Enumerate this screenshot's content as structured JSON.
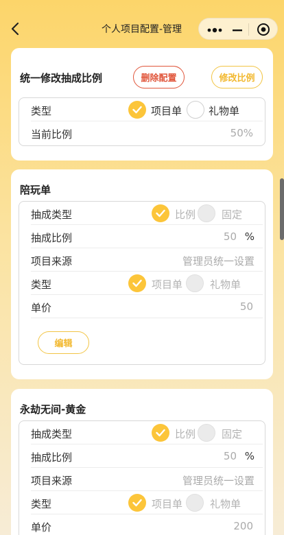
{
  "nav": {
    "title": "个人项目配置-管理"
  },
  "unified": {
    "title": "统一修改抽成比例",
    "delete_label": "删除配置",
    "edit_label": "修改比例",
    "type_label": "类型",
    "opt1": "项目单",
    "opt2": "礼物单",
    "ratio_label": "当前比例",
    "ratio_value": "50%"
  },
  "items": [
    {
      "title": "陪玩单",
      "commission_type_label": "抽成类型",
      "opt_ratio": "比例",
      "opt_fixed": "固定",
      "commission_ratio_label": "抽成比例",
      "commission_ratio_value": "50",
      "percent": "%",
      "source_label": "项目来源",
      "source_value": "管理员统一设置",
      "type_label": "类型",
      "opt1": "项目单",
      "opt2": "礼物单",
      "price_label": "单价",
      "price_value": "50",
      "edit_label": "编辑"
    },
    {
      "title": "永劫无间-黄金",
      "commission_type_label": "抽成类型",
      "opt_ratio": "比例",
      "opt_fixed": "固定",
      "commission_ratio_label": "抽成比例",
      "commission_ratio_value": "50",
      "percent": "%",
      "source_label": "项目来源",
      "source_value": "管理员统一设置",
      "type_label": "类型",
      "opt1": "项目单",
      "opt2": "礼物单",
      "price_label": "单价",
      "price_value": "200"
    }
  ],
  "colors": {
    "accent": "#fcc53a",
    "danger": "#e0553a",
    "edit": "#f2b82e"
  }
}
